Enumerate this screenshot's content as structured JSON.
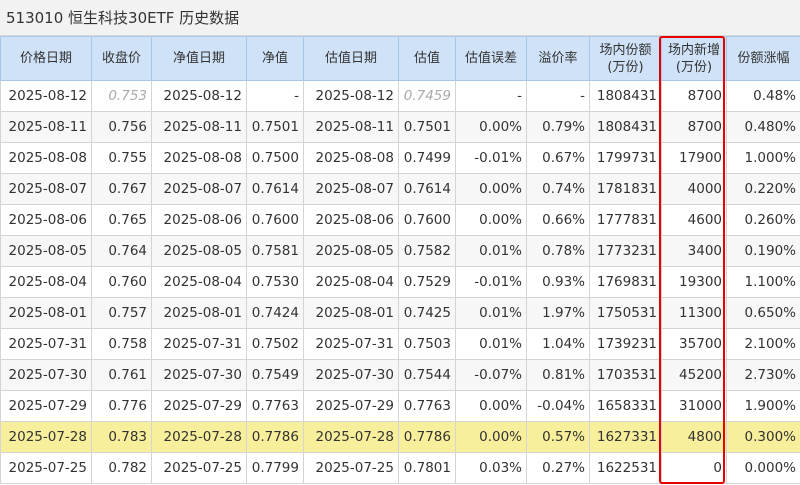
{
  "title": "513010 恒生科技30ETF 历史数据",
  "columns": [
    [
      "价格日期"
    ],
    [
      "收盘价"
    ],
    [
      "净值日期"
    ],
    [
      "净值"
    ],
    [
      "估值日期"
    ],
    [
      "估值"
    ],
    [
      "估值误差"
    ],
    [
      "溢价率"
    ],
    [
      "场内份额",
      "(万份)"
    ],
    [
      "场内新增",
      "(万份)"
    ],
    [
      "份额涨幅"
    ]
  ],
  "rows": [
    [
      "2025-08-12",
      "0.753",
      "2025-08-12",
      "-",
      "2025-08-12",
      "0.7459",
      "-",
      "-",
      "1808431",
      "8700",
      "0.48%"
    ],
    [
      "2025-08-11",
      "0.756",
      "2025-08-11",
      "0.7501",
      "2025-08-11",
      "0.7501",
      "0.00%",
      "0.79%",
      "1808431",
      "8700",
      "0.480%"
    ],
    [
      "2025-08-08",
      "0.755",
      "2025-08-08",
      "0.7500",
      "2025-08-08",
      "0.7499",
      "-0.01%",
      "0.67%",
      "1799731",
      "17900",
      "1.000%"
    ],
    [
      "2025-08-07",
      "0.767",
      "2025-08-07",
      "0.7614",
      "2025-08-07",
      "0.7614",
      "0.00%",
      "0.74%",
      "1781831",
      "4000",
      "0.220%"
    ],
    [
      "2025-08-06",
      "0.765",
      "2025-08-06",
      "0.7600",
      "2025-08-06",
      "0.7600",
      "0.00%",
      "0.66%",
      "1777831",
      "4600",
      "0.260%"
    ],
    [
      "2025-08-05",
      "0.764",
      "2025-08-05",
      "0.7581",
      "2025-08-05",
      "0.7582",
      "0.01%",
      "0.78%",
      "1773231",
      "3400",
      "0.190%"
    ],
    [
      "2025-08-04",
      "0.760",
      "2025-08-04",
      "0.7530",
      "2025-08-04",
      "0.7529",
      "-0.01%",
      "0.93%",
      "1769831",
      "19300",
      "1.100%"
    ],
    [
      "2025-08-01",
      "0.757",
      "2025-08-01",
      "0.7424",
      "2025-08-01",
      "0.7425",
      "0.01%",
      "1.97%",
      "1750531",
      "11300",
      "0.650%"
    ],
    [
      "2025-07-31",
      "0.758",
      "2025-07-31",
      "0.7502",
      "2025-07-31",
      "0.7503",
      "0.01%",
      "1.04%",
      "1739231",
      "35700",
      "2.100%"
    ],
    [
      "2025-07-30",
      "0.761",
      "2025-07-30",
      "0.7549",
      "2025-07-30",
      "0.7544",
      "-0.07%",
      "0.81%",
      "1703531",
      "45200",
      "2.730%"
    ],
    [
      "2025-07-29",
      "0.776",
      "2025-07-29",
      "0.7763",
      "2025-07-29",
      "0.7763",
      "0.00%",
      "-0.04%",
      "1658331",
      "31000",
      "1.900%"
    ],
    [
      "2025-07-28",
      "0.783",
      "2025-07-28",
      "0.7786",
      "2025-07-28",
      "0.7786",
      "0.00%",
      "0.57%",
      "1627331",
      "4800",
      "0.300%"
    ],
    [
      "2025-07-25",
      "0.782",
      "2025-07-25",
      "0.7799",
      "2025-07-25",
      "0.7801",
      "0.03%",
      "0.27%",
      "1622531",
      "0",
      "0.000%"
    ]
  ],
  "highlight_row": 11,
  "dim_cells": [
    [
      0,
      1
    ],
    [
      0,
      5
    ]
  ],
  "colors": {
    "header_bg": "#cfe2f7",
    "highlight_row_bg": "#f8ef9c",
    "red_box": "#e60000"
  }
}
